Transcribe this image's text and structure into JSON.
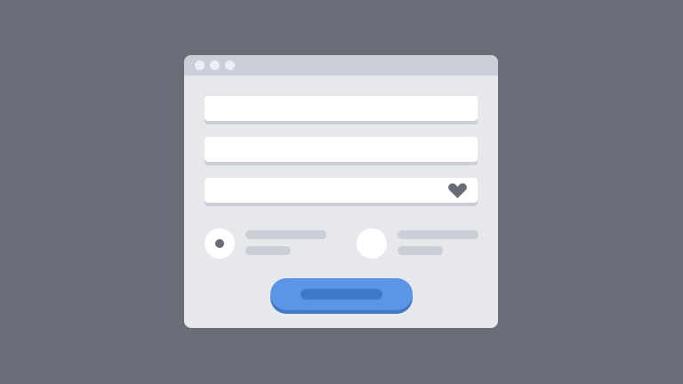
{
  "window": {
    "controls": [
      "window-dot",
      "window-dot",
      "window-dot"
    ]
  },
  "form": {
    "fields": [
      {
        "value": "",
        "placeholder": ""
      },
      {
        "value": "",
        "placeholder": ""
      },
      {
        "value": "",
        "placeholder": "",
        "icon": "heart-icon"
      }
    ],
    "options": [
      {
        "selected": true
      },
      {
        "selected": false
      }
    ],
    "submit_label": ""
  },
  "colors": {
    "background": "#686d78",
    "window": "#e6e8ec",
    "titlebar": "#cbced6",
    "field": "#ffffff",
    "accent": "#5b95e6",
    "accent_dark": "#3f78c8"
  }
}
